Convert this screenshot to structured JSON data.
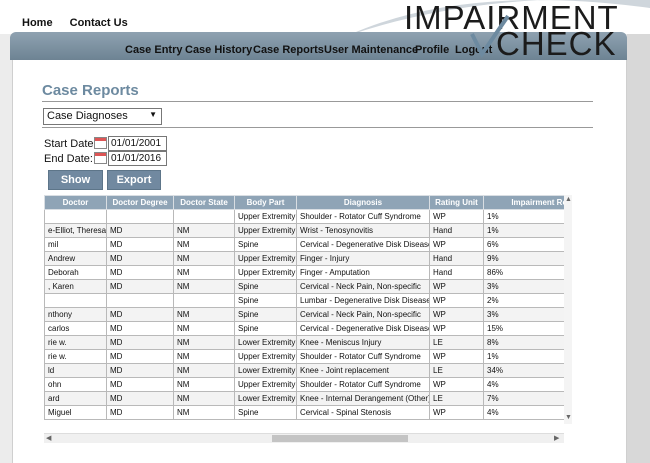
{
  "top_nav": [
    "Home",
    "Contact Us"
  ],
  "logo": {
    "line1": "IMPAIRMENT",
    "line2": "CHECK"
  },
  "main_nav": [
    "Case Entry",
    "Case History",
    "Case Reports",
    "User Maintenance",
    "Profile",
    "Logout"
  ],
  "page": {
    "title": "Case Reports",
    "report_type": "Case Diagnoses",
    "start_date_label": "Start Date:",
    "start_date": "01/01/2001",
    "end_date_label": "End Date:",
    "end_date": "01/01/2016",
    "show_button": "Show",
    "export_button": "Export"
  },
  "table": {
    "columns": [
      "Doctor",
      "Doctor Degree",
      "Doctor State",
      "Body Part",
      "Diagnosis",
      "Rating Unit",
      "Impairment Repo"
    ],
    "rows": [
      [
        "",
        "",
        "",
        "Upper Extremity",
        "Shoulder - Rotator Cuff Syndrome",
        "WP",
        "1%"
      ],
      [
        "e-Elliot, Theresa",
        "MD",
        "NM",
        "Upper Extremity",
        "Wrist - Tenosynovitis",
        "Hand",
        "1%"
      ],
      [
        "mil",
        "MD",
        "NM",
        "Spine",
        "Cervical - Degenerative Disk Disease",
        "WP",
        "6%"
      ],
      [
        "Andrew",
        "MD",
        "NM",
        "Upper Extremity",
        "Finger - Injury",
        "Hand",
        "9%"
      ],
      [
        "Deborah",
        "MD",
        "NM",
        "Upper Extremity",
        "Finger - Amputation",
        "Hand",
        "86%"
      ],
      [
        ", Karen",
        "MD",
        "NM",
        "Spine",
        "Cervical - Neck Pain, Non-specific",
        "WP",
        "3%"
      ],
      [
        "",
        "",
        "",
        "Spine",
        "Lumbar - Degenerative Disk Disease",
        "WP",
        "2%"
      ],
      [
        "nthony",
        "MD",
        "NM",
        "Spine",
        "Cervical - Neck Pain, Non-specific",
        "WP",
        "3%"
      ],
      [
        "carlos",
        "MD",
        "NM",
        "Spine",
        "Cervical - Degenerative Disk Disease",
        "WP",
        "15%"
      ],
      [
        "rie w.",
        "MD",
        "NM",
        "Lower Extremity",
        "Knee - Meniscus Injury",
        "LE",
        "8%"
      ],
      [
        "rie w.",
        "MD",
        "NM",
        "Upper Extremity",
        "Shoulder - Rotator Cuff Syndrome",
        "WP",
        "1%"
      ],
      [
        "ld",
        "MD",
        "NM",
        "Lower Extremity",
        "Knee - Joint replacement",
        "LE",
        "34%"
      ],
      [
        "ohn",
        "MD",
        "NM",
        "Upper Extremity",
        "Shoulder - Rotator Cuff Syndrome",
        "WP",
        "4%"
      ],
      [
        "ard",
        "MD",
        "NM",
        "Lower Extremity",
        "Knee - Internal Derangement (Other)",
        "LE",
        "7%"
      ],
      [
        "Miguel",
        "MD",
        "NM",
        "Spine",
        "Cervical - Spinal Stenosis",
        "WP",
        "4%"
      ]
    ]
  },
  "icons": {
    "calendar": "calendar-icon",
    "dropdown": "chevron-down-icon"
  }
}
